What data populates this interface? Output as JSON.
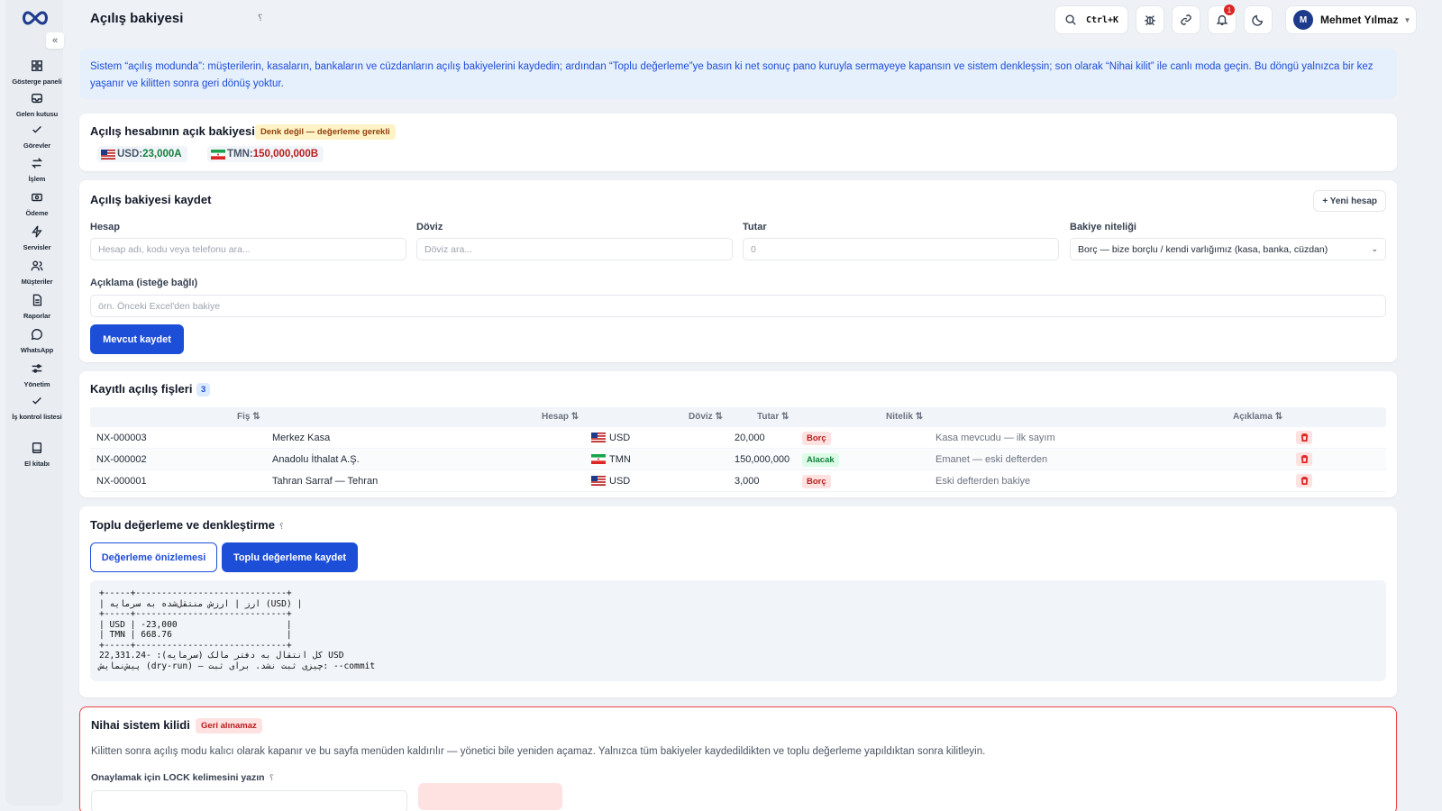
{
  "header": {
    "title": "Açılış bakiyesi",
    "help": "؟",
    "search_shortcut": "Ctrl+K",
    "notification_count": "1",
    "user_initial": "M",
    "user_name": "Mehmet Yılmaz"
  },
  "sidebar": {
    "items": [
      {
        "label": "Gösterge paneli",
        "icon": "dashboard-icon"
      },
      {
        "label": "Gelen kutusu",
        "icon": "inbox-icon"
      },
      {
        "label": "Görevler",
        "icon": "check-icon"
      },
      {
        "label": "İşlem",
        "icon": "transfer-icon"
      },
      {
        "label": "Ödeme",
        "icon": "payment-icon"
      },
      {
        "label": "Servisler",
        "icon": "bolt-icon"
      },
      {
        "label": "Müşteriler",
        "icon": "users-icon"
      },
      {
        "label": "Raporlar",
        "icon": "report-icon"
      },
      {
        "label": "WhatsApp",
        "icon": "chat-icon"
      },
      {
        "label": "Yönetim",
        "icon": "sliders-icon"
      },
      {
        "label": "İş kontrol listesi",
        "icon": "checklist-icon"
      },
      {
        "label": "El kitabı",
        "icon": "book-icon"
      }
    ]
  },
  "banner": {
    "text": "Sistem “açılış modunda”: müşterilerin, kasaların, bankaların ve cüzdanların açılış bakiyelerini kaydedin; ardından “Toplu değerleme”ye basın ki net sonuç pano kuruyla sermayeye kapansın ve sistem denkleşsin; son olarak “Nihai kilit” ile canlı moda geçin. Bu döngü yalnızca bir kez yaşanır ve kilitten sonra geri dönüş yoktur."
  },
  "open_balance": {
    "title": "Açılış hesabının açık bakiyesi",
    "badge": "Denk değil — değerleme gerekli",
    "chips": [
      {
        "code": "USD",
        "value": "23,000A"
      },
      {
        "code": "TMN",
        "value": "150,000,000B"
      }
    ]
  },
  "form": {
    "title": "Açılış bakiyesi kaydet",
    "new_account": "+ Yeni hesap",
    "account_label": "Hesap",
    "account_placeholder": "Hesap adı, kodu veya telefonu ara...",
    "currency_label": "Döviz",
    "currency_placeholder": "Döviz ara...",
    "amount_label": "Tutar",
    "amount_placeholder": "0",
    "nature_label": "Bakiye niteliği",
    "nature_value": "Borç — bize borçlu / kendi varlığımız (kasa, banka, cüzdan)",
    "desc_label": "Açıklama (isteğe bağlı)",
    "desc_placeholder": "örn. Önceki Excel'den bakiye",
    "submit": "Mevcut kaydet"
  },
  "vouchers": {
    "title": "Kayıtlı açılış fişleri",
    "count": "3",
    "columns": [
      "Fiş ⇅",
      "Hesap ⇅",
      "Döviz ⇅",
      "Tutar ⇅",
      "Nitelik ⇅",
      "Açıklama ⇅"
    ],
    "rows": [
      {
        "no": "NX-000003",
        "account": "Merkez Kasa",
        "currency": "USD",
        "amount": "20,000",
        "nature": "Borç",
        "desc": "Kasa mevcudu — ilk sayım"
      },
      {
        "no": "NX-000002",
        "account": "Anadolu İthalat A.Ş.",
        "currency": "TMN",
        "amount": "150,000,000",
        "nature": "Alacak",
        "desc": "Emanet — eski defterden"
      },
      {
        "no": "NX-000001",
        "account": "Tahran Sarraf — Tehran",
        "currency": "USD",
        "amount": "3,000",
        "nature": "Borç",
        "desc": "Eski defterden bakiye"
      }
    ]
  },
  "valuation": {
    "title": "Toplu değerleme ve denkleştirme",
    "help": "؟",
    "preview_button": "Değerleme önizlemesi",
    "save_button": "Toplu değerleme kaydet",
    "output": "+-----+-----------------------------+\n| ارز | ارزش منتقل‌شده به سرمایه (USD) |\n+-----+-----------------------------+\n| USD | -23,000                     |\n| TMN | 668.76                      |\n+-----+-----------------------------+\n22,331.24- :(سرمایه) کل انتقال به دفتر مالک USD\nپیش‌نمایش (dry-run) — چیزی ثبت نشد. برای ثبت: --commit"
  },
  "lock": {
    "title": "Nihai sistem kilidi",
    "badge": "Geri alınamaz",
    "text": "Kilitten sonra açılış modu kalıcı olarak kapanır ve bu sayfa menüden kaldırılır — yönetici bile yeniden açamaz. Yalnızca tüm bakiyeler kaydedildikten ve toplu değerleme yapıldıktan sonra kilitleyin.",
    "confirm_label": "Onaylamak için LOCK kelimesini yazın",
    "help": "؟"
  },
  "colors": {
    "primary": "#1d4ed8",
    "danger": "#ef4444",
    "success": "#15803d",
    "banner_bg": "#e6effc"
  }
}
